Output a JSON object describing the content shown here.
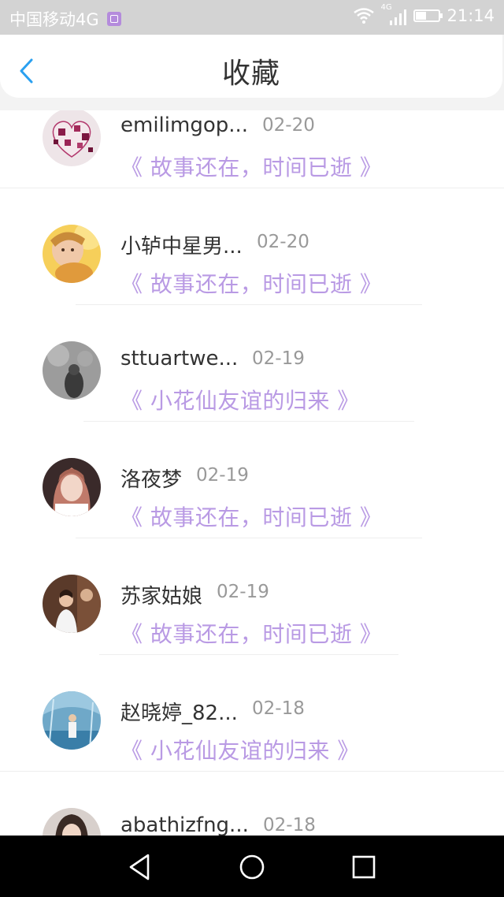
{
  "status_bar": {
    "carrier": "中国移动4G",
    "network_badge": "4G",
    "time": "21:14",
    "battery_level": 0.45
  },
  "header": {
    "title": "收藏",
    "back_icon": "chevron-left-icon"
  },
  "list": {
    "items": [
      {
        "username": "emilimgop...",
        "date": "02-20",
        "story": "《 故事还在，时间已逝 》"
      },
      {
        "username": "小轳中星男...",
        "date": "02-20",
        "story": "《 故事还在，时间已逝 》"
      },
      {
        "username": "sttuartwe...",
        "date": "02-19",
        "story": "《 小花仙友谊的归来 》"
      },
      {
        "username": "洛夜梦",
        "date": "02-19",
        "story": "《 故事还在，时间已逝 》"
      },
      {
        "username": "苏家姑娘",
        "date": "02-19",
        "story": "《 故事还在，时间已逝 》"
      },
      {
        "username": "赵晓婷_82...",
        "date": "02-18",
        "story": "《 小花仙友谊的归来 》"
      },
      {
        "username": "abathizfng...",
        "date": "02-18",
        "story": ""
      }
    ]
  },
  "colors": {
    "story_text": "#b99ae4",
    "back_arrow": "#2aa0f0",
    "status_bar_bg": "#d3d3d3",
    "nav_bar_bg": "#000000"
  },
  "nav_bar": {
    "back_icon": "triangle-back-icon",
    "home_icon": "circle-home-icon",
    "recents_icon": "square-recents-icon"
  }
}
